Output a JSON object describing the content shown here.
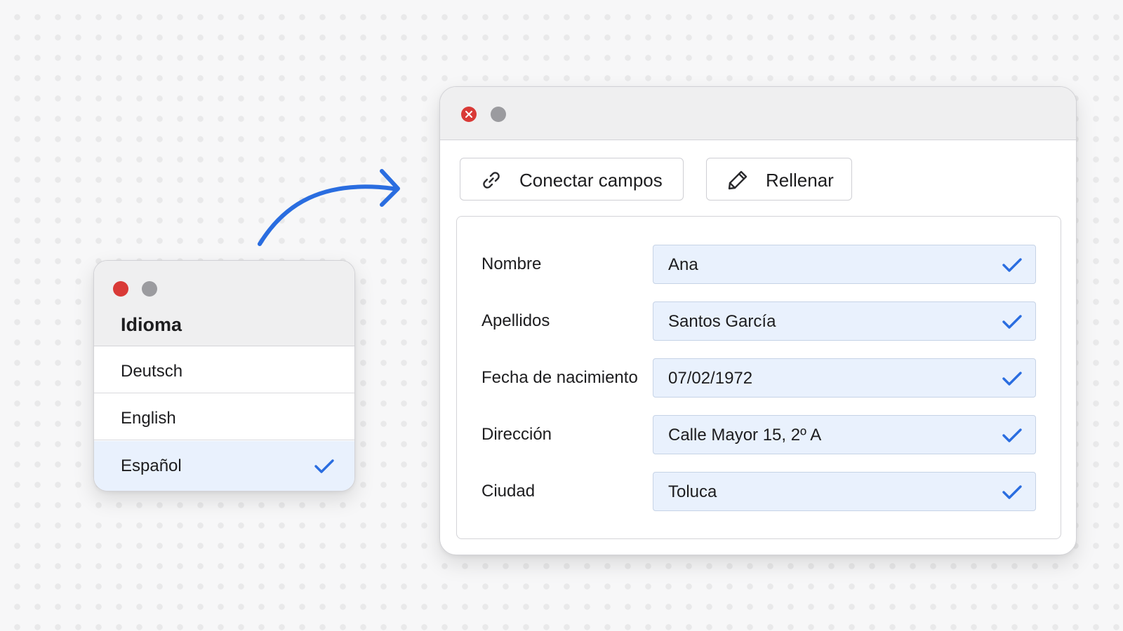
{
  "colors": {
    "accent": "#2a6de0",
    "close_red": "#d93a37",
    "minimize_grey": "#9b9b9f",
    "field_fill": "#e9f1fd"
  },
  "language_window": {
    "title": "Idioma",
    "items": [
      {
        "label": "Deutsch",
        "selected": false
      },
      {
        "label": "English",
        "selected": false
      },
      {
        "label": "Español",
        "selected": true
      }
    ]
  },
  "form_window": {
    "toolbar": {
      "connect_label": "Conectar campos",
      "connect_icon": "link-icon",
      "fill_label": "Rellenar",
      "fill_icon": "pencil-icon"
    },
    "fields": [
      {
        "label": "Nombre",
        "value": "Ana",
        "verified": true
      },
      {
        "label": "Apellidos",
        "value": "Santos García",
        "verified": true
      },
      {
        "label": "Fecha de nacimiento",
        "value": "07/02/1972",
        "verified": true
      },
      {
        "label": "Dirección",
        "value": "Calle Mayor 15, 2º A",
        "verified": true
      },
      {
        "label": "Ciudad",
        "value": "Toluca",
        "verified": true
      }
    ]
  }
}
